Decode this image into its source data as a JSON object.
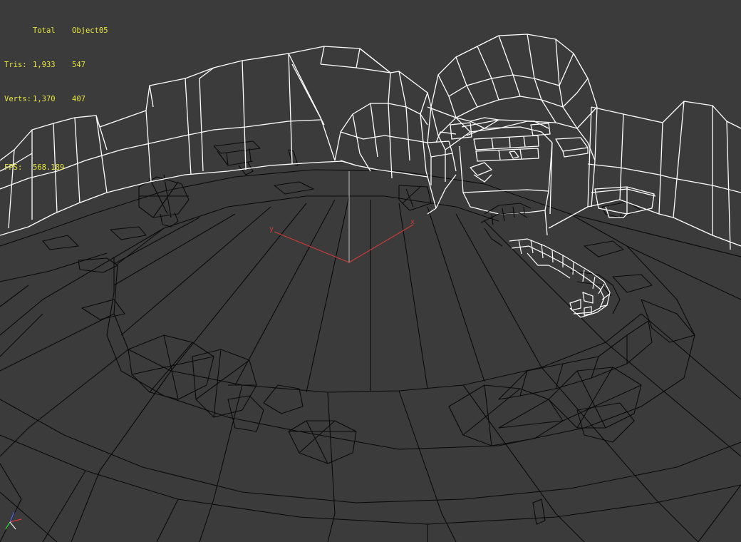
{
  "stats": {
    "header_total": "Total",
    "header_object": "Object05",
    "tris_label": "Tris:",
    "tris_total": "1,933",
    "tris_object": "547",
    "verts_label": "Verts:",
    "verts_total": "1,370",
    "verts_object": "407",
    "fps_label": "FPS:",
    "fps_value": "568.189"
  },
  "axes": {
    "x_label": "x",
    "y_label": "y",
    "x_color": "#d23a3a",
    "y_color": "#d23a3a"
  },
  "colors": {
    "background": "#3b3b3b",
    "stats_text": "#e6e640",
    "selected_wire": "#ffffff",
    "unselected_wire": "#0a0a0a"
  }
}
